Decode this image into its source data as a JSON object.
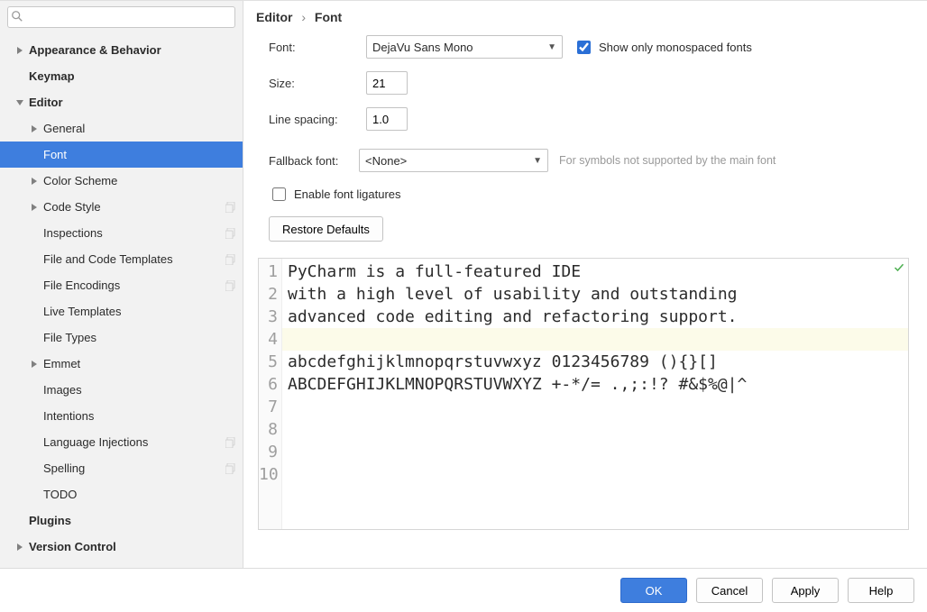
{
  "search": {
    "placeholder": ""
  },
  "sidebar": {
    "items": [
      {
        "label": "Appearance & Behavior",
        "depth": 0,
        "arrow": "right",
        "bold": true
      },
      {
        "label": "Keymap",
        "depth": 0,
        "arrow": "",
        "bold": true
      },
      {
        "label": "Editor",
        "depth": 0,
        "arrow": "down",
        "bold": true
      },
      {
        "label": "General",
        "depth": 1,
        "arrow": "right"
      },
      {
        "label": "Font",
        "depth": 1,
        "arrow": "",
        "selected": true
      },
      {
        "label": "Color Scheme",
        "depth": 1,
        "arrow": "right"
      },
      {
        "label": "Code Style",
        "depth": 1,
        "arrow": "right",
        "badge": true
      },
      {
        "label": "Inspections",
        "depth": 1,
        "arrow": "",
        "badge": true
      },
      {
        "label": "File and Code Templates",
        "depth": 1,
        "arrow": "",
        "badge": true
      },
      {
        "label": "File Encodings",
        "depth": 1,
        "arrow": "",
        "badge": true
      },
      {
        "label": "Live Templates",
        "depth": 1,
        "arrow": ""
      },
      {
        "label": "File Types",
        "depth": 1,
        "arrow": ""
      },
      {
        "label": "Emmet",
        "depth": 1,
        "arrow": "right"
      },
      {
        "label": "Images",
        "depth": 1,
        "arrow": ""
      },
      {
        "label": "Intentions",
        "depth": 1,
        "arrow": ""
      },
      {
        "label": "Language Injections",
        "depth": 1,
        "arrow": "",
        "badge": true
      },
      {
        "label": "Spelling",
        "depth": 1,
        "arrow": "",
        "badge": true
      },
      {
        "label": "TODO",
        "depth": 1,
        "arrow": ""
      },
      {
        "label": "Plugins",
        "depth": 0,
        "arrow": "",
        "bold": true
      },
      {
        "label": "Version Control",
        "depth": 0,
        "arrow": "right",
        "bold": true
      }
    ]
  },
  "breadcrumb": {
    "root": "Editor",
    "leaf": "Font",
    "sep": "›"
  },
  "form": {
    "font_label": "Font:",
    "font_value": "DejaVu Sans Mono",
    "mono_only_label": "Show only monospaced fonts",
    "mono_only_checked": true,
    "size_label": "Size:",
    "size_value": "21",
    "spacing_label": "Line spacing:",
    "spacing_value": "1.0",
    "fallback_label": "Fallback font:",
    "fallback_value": "<None>",
    "fallback_hint": "For symbols not supported by the main font",
    "ligatures_label": "Enable font ligatures",
    "ligatures_checked": false,
    "restore_label": "Restore Defaults"
  },
  "preview": {
    "line_numbers": [
      "1",
      "2",
      "3",
      "4",
      "5",
      "6",
      "7",
      "8",
      "9",
      "10"
    ],
    "lines": [
      "PyCharm is a full-featured IDE",
      "with a high level of usability and outstanding",
      "advanced code editing and refactoring support.",
      "",
      "abcdefghijklmnopqrstuvwxyz 0123456789 (){}[]",
      "ABCDEFGHIJKLMNOPQRSTUVWXYZ +-*/= .,;:!? #&$%@|^",
      "",
      "",
      "",
      ""
    ],
    "highlight_line_index": 3
  },
  "footer": {
    "ok": "OK",
    "cancel": "Cancel",
    "apply": "Apply",
    "help": "Help"
  }
}
